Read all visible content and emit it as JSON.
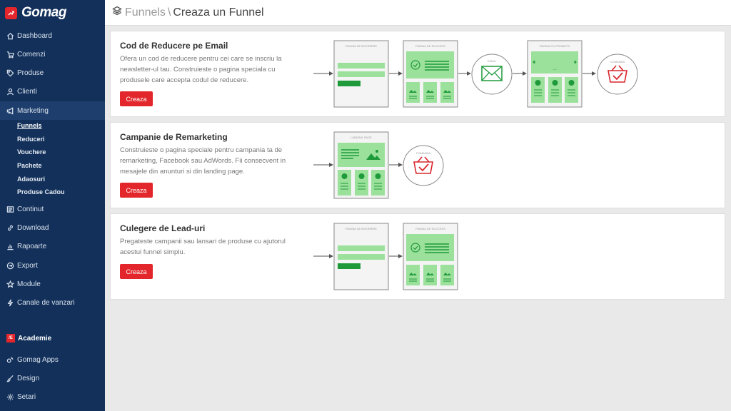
{
  "app": {
    "brand": "Gomag"
  },
  "sidebar": {
    "items": [
      {
        "label": "Dashboard",
        "icon": "home-icon"
      },
      {
        "label": "Comenzi",
        "icon": "cart-icon"
      },
      {
        "label": "Produse",
        "icon": "tag-icon"
      },
      {
        "label": "Clienti",
        "icon": "user-icon"
      },
      {
        "label": "Marketing",
        "icon": "megaphone-icon"
      }
    ],
    "marketing_sub": [
      {
        "label": "Funnels"
      },
      {
        "label": "Reduceri"
      },
      {
        "label": "Vouchere"
      },
      {
        "label": "Pachete"
      },
      {
        "label": "Adaosuri"
      },
      {
        "label": "Produse Cadou"
      }
    ],
    "items2": [
      {
        "label": "Continut",
        "icon": "document-icon"
      },
      {
        "label": "Download",
        "icon": "link-icon"
      },
      {
        "label": "Rapoarte",
        "icon": "chart-icon"
      },
      {
        "label": "Export",
        "icon": "export-icon"
      },
      {
        "label": "Module",
        "icon": "star-icon"
      },
      {
        "label": "Canale de vanzari",
        "icon": "bolt-icon"
      }
    ],
    "academie": {
      "badge": "/E",
      "label": "Academie"
    },
    "bottom": [
      {
        "label": "Gomag Apps",
        "icon": "apps-icon"
      },
      {
        "label": "Design",
        "icon": "brush-icon"
      },
      {
        "label": "Setari",
        "icon": "gear-icon"
      }
    ]
  },
  "header": {
    "parent": "Funnels",
    "separator": "\\",
    "current": "Creaza un Funnel"
  },
  "cards": [
    {
      "title": "Cod de Reducere pe Email",
      "description": "Ofera un cod de reducere pentru cei care se inscriu la newsletter-ul tau. Construieste o pagina speciala cu produsele care accepta codul de reducere.",
      "button": "Creaza",
      "diagram": {
        "signup_label": "PAGINA DE INSCRIERE",
        "success_label": "PAGINA DE SUCCESS",
        "email_label": "EMAIL",
        "promo_label": "PAGINA CU PROMOTII",
        "order_label": "COMANDA",
        "promo_dots": "..."
      }
    },
    {
      "title": "Campanie de Remarketing",
      "description": "Construieste o pagina speciale pentru campania ta de remarketing, Facebook sau AdWords. Fii consecvent in mesajele din anunturi si din landing page.",
      "button": "Creaza",
      "diagram": {
        "landing_label": "LANDING PAGE",
        "order_label": "COMANDA"
      }
    },
    {
      "title": "Culegere de Lead-uri",
      "description": "Pregateste campanii sau lansari de produse cu ajutorul acestui funnel simplu.",
      "button": "Creaza",
      "diagram": {
        "signup_label": "PAGINA DE INSCRIERE",
        "success_label": "PAGINA DE SUCCESS"
      }
    }
  ],
  "colors": {
    "sidebar": "#12305a",
    "accent": "#e2262b",
    "diagram_green": "#9be09b",
    "diagram_dark_green": "#1f9a3a"
  }
}
